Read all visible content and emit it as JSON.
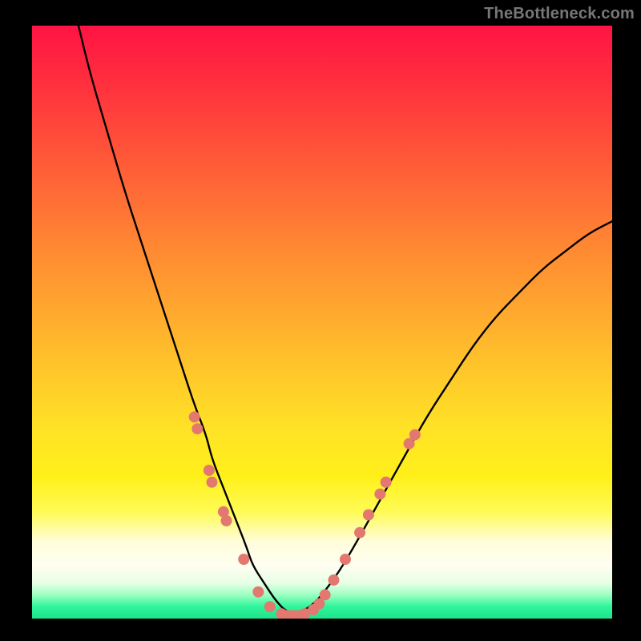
{
  "watermark": "TheBottleneck.com",
  "chart_data": {
    "type": "line",
    "title": "",
    "xlabel": "",
    "ylabel": "",
    "xlim": [
      0,
      100
    ],
    "ylim": [
      0,
      100
    ],
    "grid": false,
    "legend": false,
    "series": [
      {
        "name": "bottleneck-curve",
        "x": [
          8,
          10,
          13,
          16,
          19,
          22,
          24,
          26,
          28,
          30,
          31,
          33,
          35,
          37,
          38,
          40,
          42,
          44,
          46,
          48,
          50,
          53,
          56,
          60,
          64,
          68,
          72,
          76,
          80,
          84,
          88,
          92,
          96,
          100
        ],
        "y": [
          100,
          92,
          82,
          72,
          63,
          54,
          48,
          42,
          36,
          31,
          27,
          22,
          17,
          12,
          9,
          6,
          3,
          1,
          1,
          2,
          4,
          8,
          13,
          20,
          27,
          34,
          40,
          46,
          51,
          55,
          59,
          62,
          65,
          67
        ],
        "stroke": "#000000",
        "stroke_width": 2
      }
    ],
    "markers": {
      "name": "highlighted-points",
      "color": "#e2786f",
      "radius": 7,
      "points": [
        {
          "x": 28.0,
          "y": 34
        },
        {
          "x": 28.5,
          "y": 32
        },
        {
          "x": 30.5,
          "y": 25
        },
        {
          "x": 31.0,
          "y": 23
        },
        {
          "x": 33.0,
          "y": 18
        },
        {
          "x": 33.5,
          "y": 16.5
        },
        {
          "x": 36.5,
          "y": 10
        },
        {
          "x": 39.0,
          "y": 4.5
        },
        {
          "x": 41.0,
          "y": 2
        },
        {
          "x": 43.0,
          "y": 0.8
        },
        {
          "x": 44.0,
          "y": 0.5
        },
        {
          "x": 45.0,
          "y": 0.5
        },
        {
          "x": 46.0,
          "y": 0.5
        },
        {
          "x": 47.0,
          "y": 0.8
        },
        {
          "x": 48.5,
          "y": 1.5
        },
        {
          "x": 49.5,
          "y": 2.5
        },
        {
          "x": 50.5,
          "y": 4
        },
        {
          "x": 52.0,
          "y": 6.5
        },
        {
          "x": 54.0,
          "y": 10
        },
        {
          "x": 56.5,
          "y": 14.5
        },
        {
          "x": 58.0,
          "y": 17.5
        },
        {
          "x": 60.0,
          "y": 21
        },
        {
          "x": 61.0,
          "y": 23
        },
        {
          "x": 65.0,
          "y": 29.5
        },
        {
          "x": 66.0,
          "y": 31
        }
      ]
    },
    "background_gradient_stops": [
      {
        "pos": 0,
        "color": "#ff1444"
      },
      {
        "pos": 40,
        "color": "#ff8a32"
      },
      {
        "pos": 70,
        "color": "#ffe226"
      },
      {
        "pos": 90,
        "color": "#fffef0"
      },
      {
        "pos": 100,
        "color": "#20e38c"
      }
    ]
  }
}
